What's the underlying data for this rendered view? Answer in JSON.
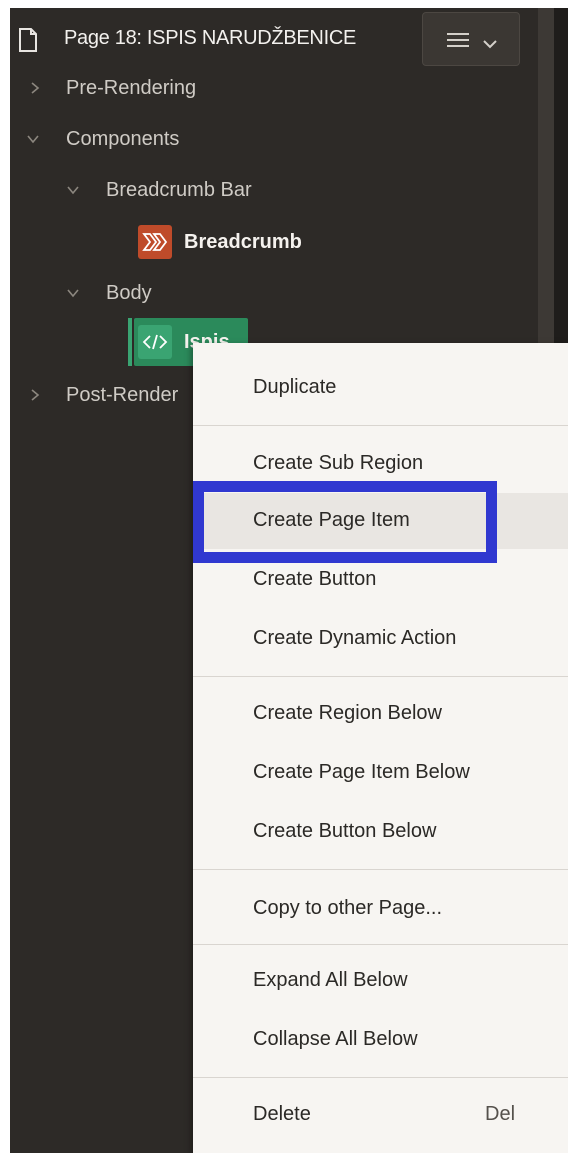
{
  "header": {
    "title": "Page 18: ISPIS NARUDŽBENICE",
    "menu_icon": "hamburger-icon"
  },
  "tree": {
    "pre_rendering": "Pre-Rendering",
    "components": "Components",
    "breadcrumb_bar": "Breadcrumb Bar",
    "breadcrumb": "Breadcrumb",
    "body": "Body",
    "ispis": "Ispis",
    "post_rendering": "Post-Render"
  },
  "context_menu": {
    "duplicate": "Duplicate",
    "create_sub_region": "Create Sub Region",
    "create_page_item": "Create Page Item",
    "create_button": "Create Button",
    "create_dynamic_action": "Create Dynamic Action",
    "create_region_below": "Create Region Below",
    "create_page_item_below": "Create Page Item Below",
    "create_button_below": "Create Button Below",
    "copy_to_other_page": "Copy to other Page...",
    "expand_all_below": "Expand All Below",
    "collapse_all_below": "Collapse All Below",
    "delete": "Delete",
    "delete_shortcut": "Del"
  },
  "colors": {
    "breadcrumb_badge": "#bf4b2a",
    "region_badge": "#3aa472",
    "focus_outline": "#3038d0"
  }
}
